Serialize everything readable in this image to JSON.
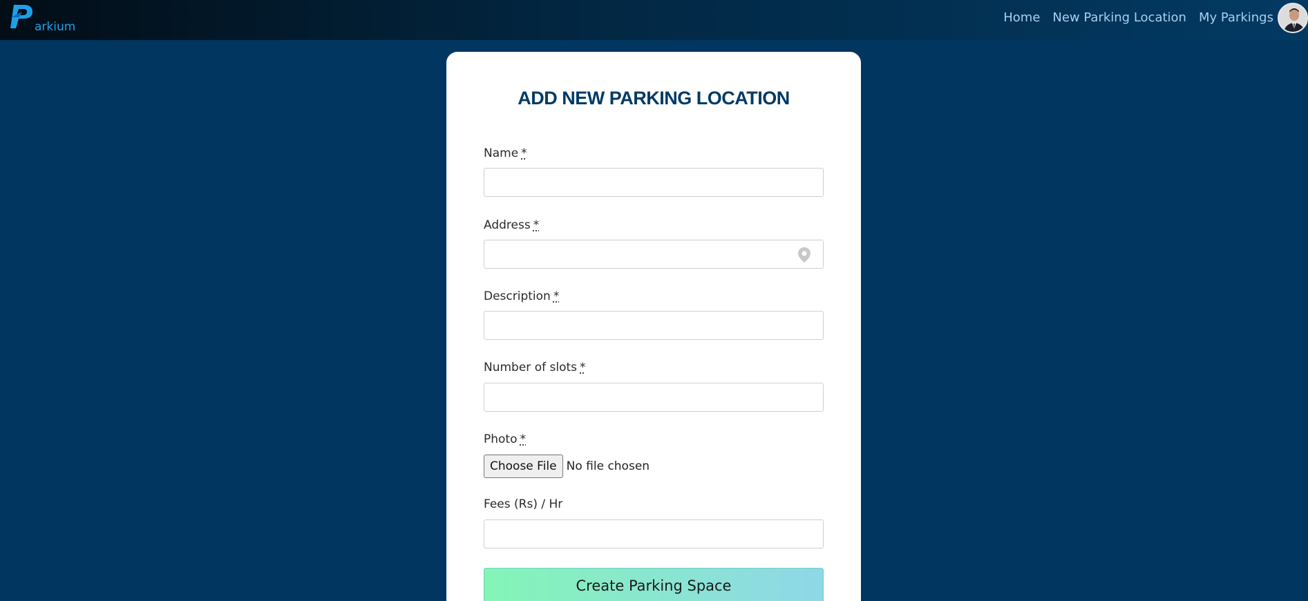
{
  "brand": {
    "logo_letter": "P",
    "logo_text": "arkium"
  },
  "nav": {
    "links": [
      {
        "label": "Home"
      },
      {
        "label": "New Parking Location"
      },
      {
        "label": "My Parkings"
      }
    ]
  },
  "form": {
    "title": "ADD NEW PARKING LOCATION",
    "required_marker": "*",
    "fields": {
      "name": {
        "label": "Name",
        "value": ""
      },
      "address": {
        "label": "Address",
        "value": ""
      },
      "description": {
        "label": "Description",
        "value": ""
      },
      "slots": {
        "label": "Number of slots",
        "value": ""
      },
      "photo": {
        "label": "Photo",
        "button": "Choose File",
        "status": "No file chosen"
      },
      "fees": {
        "label": "Fees (Rs) / Hr",
        "value": ""
      }
    },
    "submit_label": "Create Parking Space"
  },
  "colors": {
    "page_bg": "#003660",
    "title": "#003a66",
    "brand_blue": "#1ea0e8",
    "nav_link": "#a8cff0",
    "submit_gradient_start": "#84f5b6",
    "submit_gradient_end": "#8fd7e8"
  }
}
